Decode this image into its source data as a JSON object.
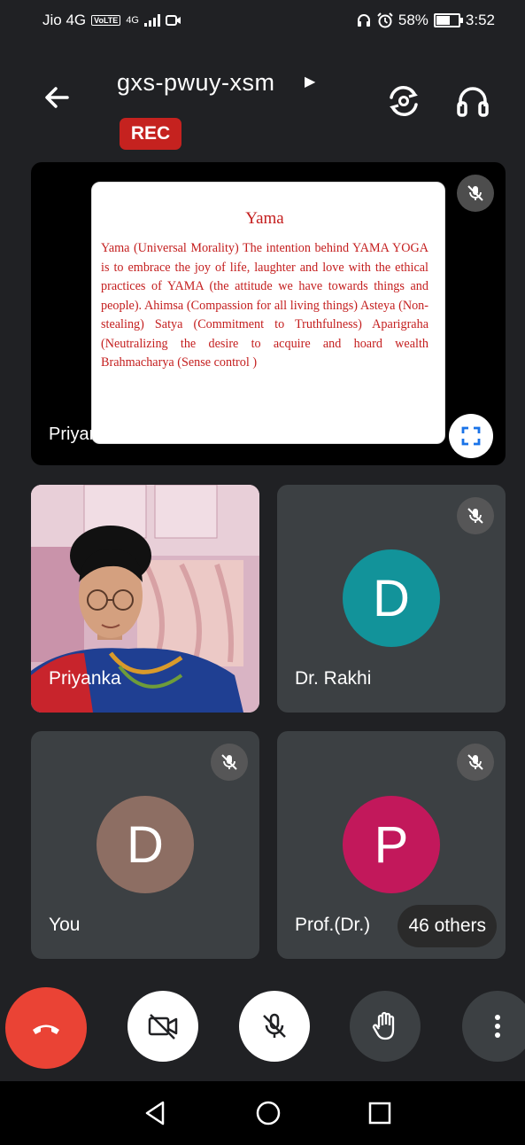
{
  "status_bar": {
    "carrier": "Jio 4G",
    "volte": "VoLTE",
    "signal": "4G",
    "battery": "58%",
    "battery_level": 0.58,
    "time": "3:52"
  },
  "meeting": {
    "code": "gxs-pwuy-xsm",
    "recording_label": "REC"
  },
  "presentation": {
    "slide_title": "Yama",
    "slide_body": "Yama (Universal Morality) The intention behind YAMA YOGA is to embrace the joy of life, laughter and love with the ethical practices of YAMA (the attitude we have towards things and people). Ahimsa (Compassion for all living things) Asteya (Non-stealing) Satya (Commitment to Truthfulness) Aparigraha (Neutralizing the desire to acquire and hoard wealth Brahmacharya (Sense control )",
    "presenting_label": "Priyanka is presenting"
  },
  "participants": [
    {
      "name": "Priyanka",
      "video": true
    },
    {
      "name": "Dr. Rakhi",
      "initial": "D",
      "color": "#12939a",
      "muted": true
    },
    {
      "name": "You",
      "initial": "D",
      "color": "#8d6e63",
      "muted": true
    },
    {
      "name": "Prof.(Dr.)",
      "initial": "P",
      "color": "#c2185b",
      "muted": true
    }
  ],
  "others_count_label": "46 others",
  "colors": {
    "background": "#202124",
    "tile": "#3c4043",
    "hangup": "#ea4335",
    "rec": "#c5221f",
    "slide_text": "#c41e1e"
  }
}
